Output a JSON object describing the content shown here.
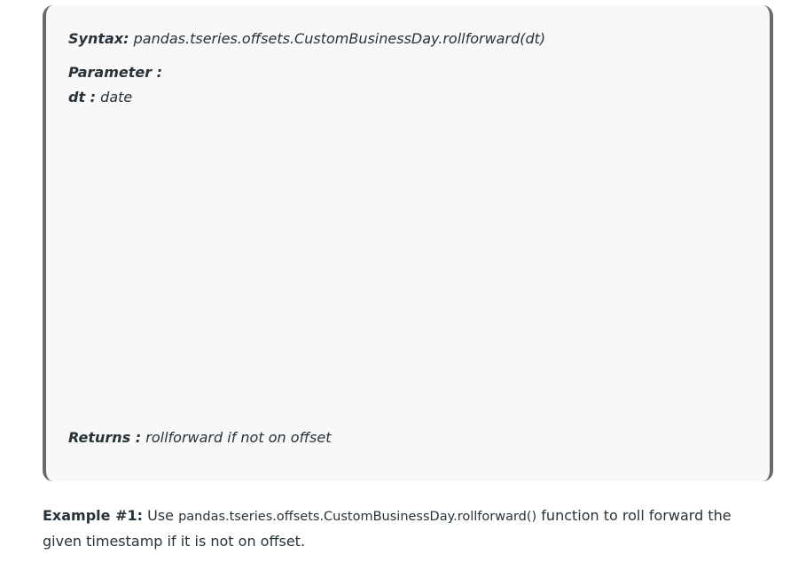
{
  "syntax_box": {
    "syntax_label": "Syntax:",
    "syntax_value": "pandas.tseries.offsets.CustomBusinessDay.rollforward(dt)",
    "parameter_heading": "Parameter :",
    "param_name": "dt :",
    "param_value": "date",
    "returns_label": "Returns :",
    "returns_value": "rollforward if not on offset"
  },
  "example": {
    "label": "Example #1:",
    "text_before": "Use",
    "function_name": "pandas.tseries.offsets.CustomBusinessDay.rollforward()",
    "text_after": "function to roll forward the given timestamp if it is not on offset."
  }
}
